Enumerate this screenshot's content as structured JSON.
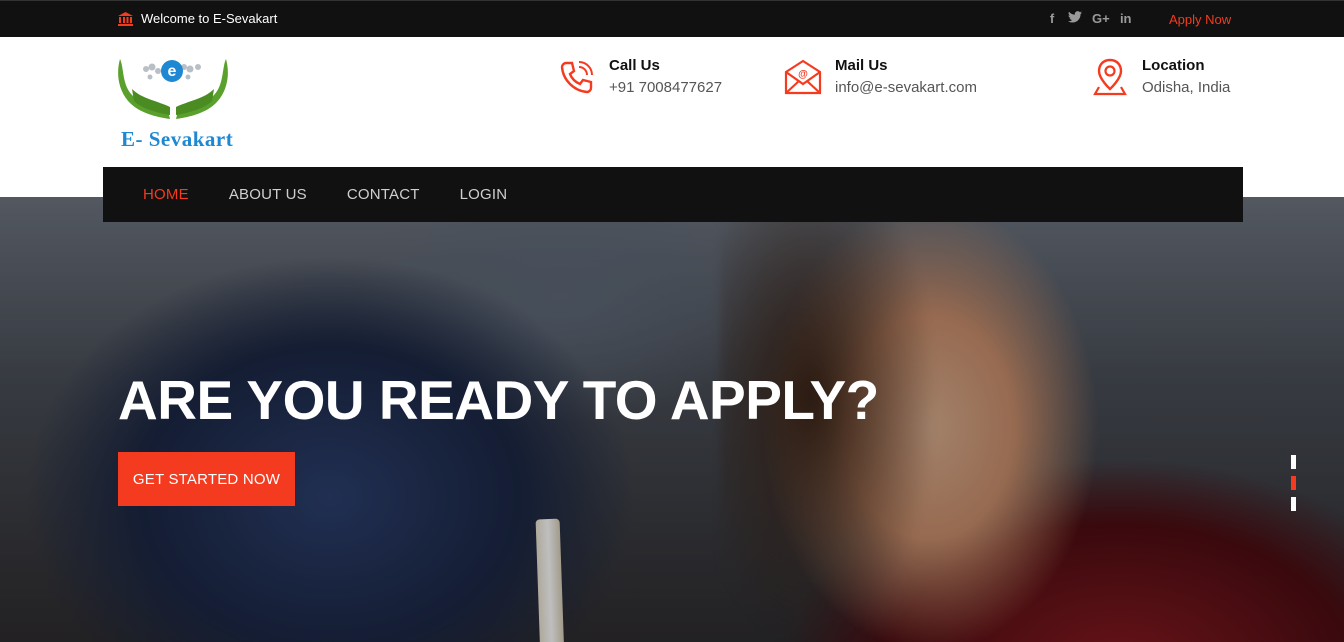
{
  "topbar": {
    "welcome_text": "Welcome to E-Sevakart",
    "social": [
      {
        "icon": "facebook-icon",
        "glyph": "f"
      },
      {
        "icon": "twitter-icon",
        "glyph": "☵"
      },
      {
        "icon": "google-plus-icon",
        "glyph": "G+"
      },
      {
        "icon": "linkedin-icon",
        "glyph": "in"
      }
    ],
    "apply_now": "Apply Now"
  },
  "header": {
    "logo_text": "E- Sevakart",
    "call": {
      "title": "Call Us",
      "value": "+91 7008477627"
    },
    "mail": {
      "title": "Mail Us",
      "value": "info@e-sevakart.com"
    },
    "location": {
      "title": "Location",
      "value": "Odisha, India"
    }
  },
  "nav": {
    "items": [
      "HOME",
      "ABOUT US",
      "CONTACT",
      "LOGIN"
    ],
    "active_index": 0
  },
  "hero": {
    "title": "ARE YOU READY TO APPLY?",
    "cta": "GET STARTED NOW",
    "slides": 3,
    "active_slide": 2
  },
  "colors": {
    "accent": "#f53b1f",
    "dark": "#111111",
    "logo_blue": "#1e88d2",
    "logo_green": "#5aa02c"
  }
}
